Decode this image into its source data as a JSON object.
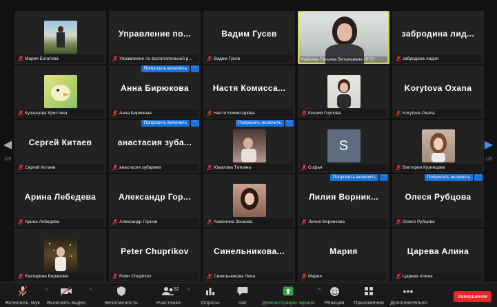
{
  "tiles": [
    {
      "big": "",
      "name": "Мария Богатова"
    },
    {
      "big": "Управление по...",
      "name": "Управление по воспитательной р..."
    },
    {
      "big": "Вадим Гусев",
      "name": "Вадим Гусев"
    },
    {
      "big": "",
      "name": "Кайсина Татьяна  Витальевна НГЛУ"
    },
    {
      "big": "забродина лид...",
      "name": "забродина лидия"
    },
    {
      "big": "",
      "name": "Кузнецова Кристина"
    },
    {
      "big": "Анна Бирюкова",
      "name": "Анна Бирюкова"
    },
    {
      "big": "Настя Комисса...",
      "name": "Настя Комиссарова"
    },
    {
      "big": "",
      "name": "Ксения Горлова"
    },
    {
      "big": "Korуtova Oxana",
      "name": "Korуtova Oxana"
    },
    {
      "big": "Сергей Китаев",
      "name": "Сергей Китаев"
    },
    {
      "big": "анастасия зуба...",
      "name": "анастасия зубарева"
    },
    {
      "big": "",
      "name": "Юматова Татьяна"
    },
    {
      "big": "S",
      "name": "Софья"
    },
    {
      "big": "",
      "name": "Виктория Кузнецова"
    },
    {
      "big": "Арина Лебедева",
      "name": "Арина Лебедева"
    },
    {
      "big": "Александр Гор...",
      "name": "Александр Горнов"
    },
    {
      "big": "",
      "name": "Анжелика Зенкова"
    },
    {
      "big": "Лилия Ворник...",
      "name": "Лилия Ворникова"
    },
    {
      "big": "Олеся Рубцова",
      "name": "Олеся Рубцова"
    },
    {
      "big": "",
      "name": "Екатерина Баранова"
    },
    {
      "big": "Peter Chuprikov",
      "name": "Peter Chuprikov"
    },
    {
      "big": "Синельникова...",
      "name": "Синельникова Лина"
    },
    {
      "big": "Мария",
      "name": "Мария"
    },
    {
      "big": "Царева Алина",
      "name": "Царева Алина"
    }
  ],
  "ask_unmute": {
    "label": "Попросить включить",
    "more": "···"
  },
  "pager": {
    "left_page": "1/3",
    "right_page": "1/3"
  },
  "toolbar": {
    "unmute": "Включить звук",
    "start_video": "Включить видео",
    "security": "Безопасность",
    "participants": "Участники",
    "participants_count": "52",
    "polls": "Опросы",
    "chat": "Чат",
    "share": "Демонстрация экрана",
    "reactions": "Реакции",
    "apps": "Приложения",
    "more": "Дополнительно",
    "end": "Завершение"
  },
  "colors": {
    "accent": "#1a73d8",
    "end": "#e02828",
    "share": "#5bbf5b",
    "active_border": "#d8d84a"
  }
}
